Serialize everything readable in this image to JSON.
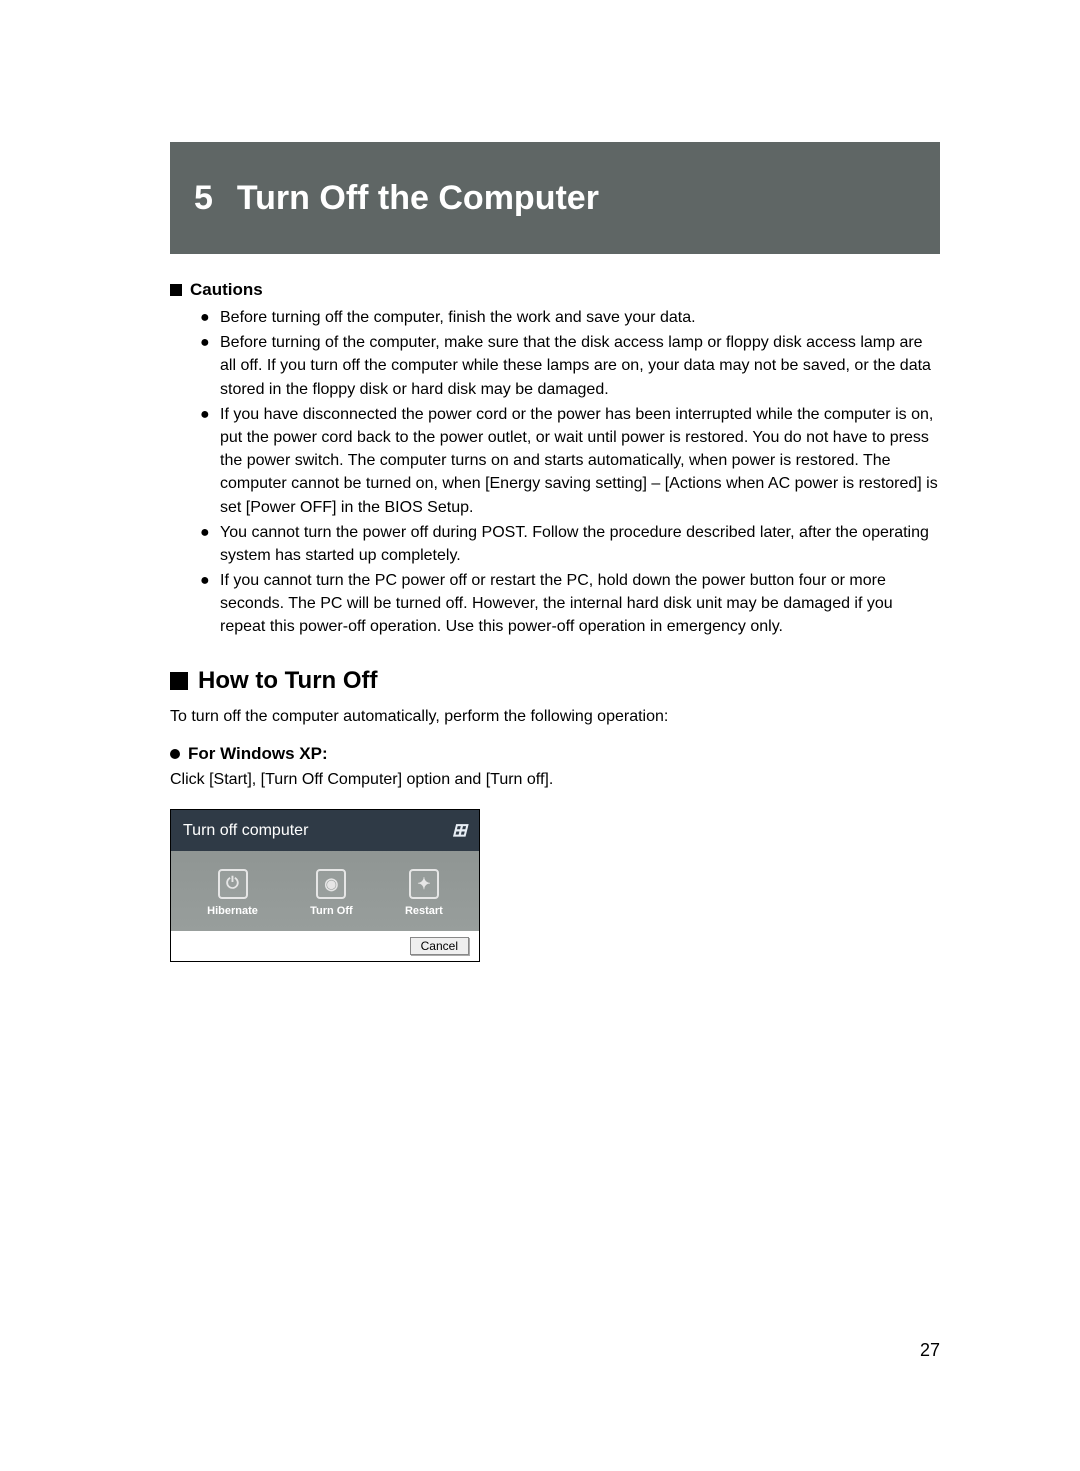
{
  "chapter": {
    "number": "5",
    "title": "Turn Off the Computer"
  },
  "cautions": {
    "heading": "Cautions",
    "items": [
      "Before turning off the computer, finish the work and save your data.",
      "Before turning of the computer, make sure that the disk access lamp or floppy disk access lamp are all off. If you turn off the computer while these lamps are on, your data may not be saved, or the data stored in the floppy disk or hard disk may be damaged.",
      "If you have disconnected the power cord or the power has been interrupted while the computer is on, put the power cord back to the power outlet, or wait until power is restored. You do not have to press the power switch. The computer turns on and starts automatically, when power is restored. The computer cannot be turned on, when [Energy saving setting] – [Actions when AC power is restored] is set [Power OFF] in the BIOS Setup.",
      "You cannot turn the power off during POST. Follow the procedure described later, after the operating system has started up completely.",
      "If you cannot turn the PC power off or restart the PC, hold down the power button four or more seconds. The PC will be turned off. However, the internal hard disk unit may be damaged if you repeat this power-off operation. Use this power-off operation in emergency only."
    ]
  },
  "howto": {
    "heading": "How to Turn Off",
    "intro": "To turn off the computer automatically, perform the following operation:",
    "xp_heading": "For Windows XP:",
    "xp_instruction": "Click [Start], [Turn Off Computer] option and [Turn off]."
  },
  "dialog": {
    "title": "Turn off computer",
    "options": {
      "hibernate": "Hibernate",
      "turnoff": "Turn Off",
      "restart": "Restart"
    },
    "cancel": "Cancel"
  },
  "page_number": "27"
}
